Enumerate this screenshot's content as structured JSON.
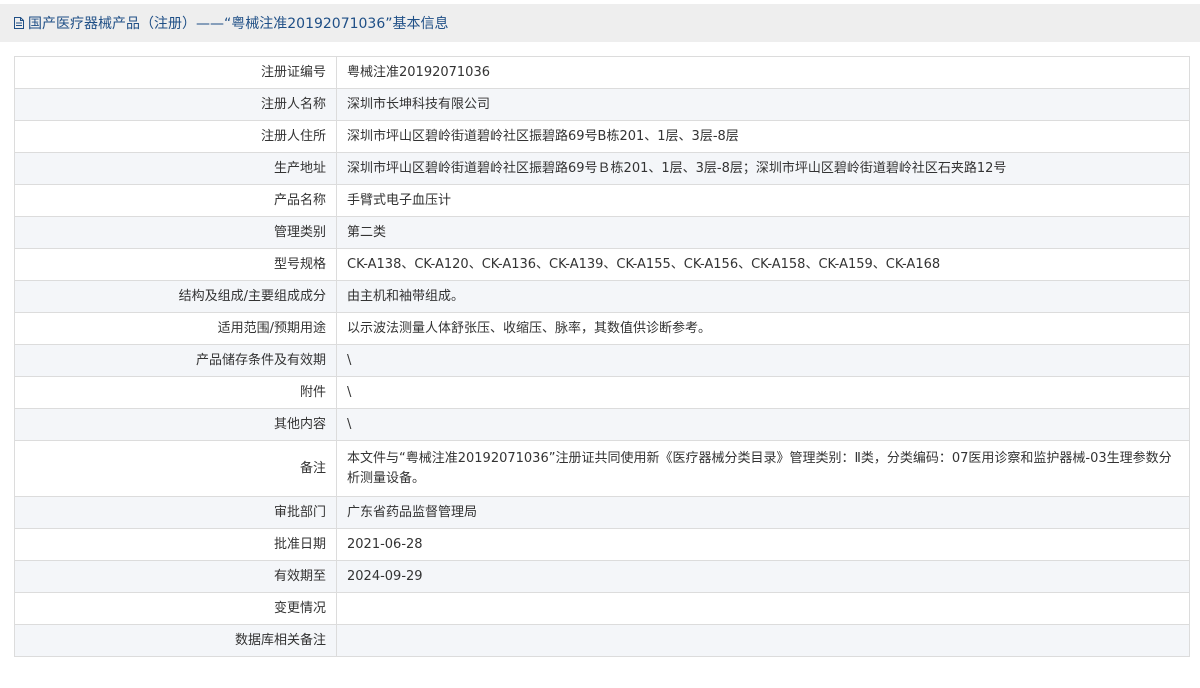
{
  "header": {
    "title": "国产医疗器械产品（注册）——“粤械注准20192071036”基本信息"
  },
  "rows": [
    {
      "label": "注册证编号",
      "value": "粤械注准20192071036"
    },
    {
      "label": "注册人名称",
      "value": "深圳市长坤科技有限公司"
    },
    {
      "label": "注册人住所",
      "value": "深圳市坪山区碧岭街道碧岭社区振碧路69号B栋201、1层、3层-8层"
    },
    {
      "label": "生产地址",
      "value": "深圳市坪山区碧岭街道碧岭社区振碧路69号Ｂ栋201、1层、3层-8层；深圳市坪山区碧岭街道碧岭社区石夹路12号"
    },
    {
      "label": "产品名称",
      "value": "手臂式电子血压计"
    },
    {
      "label": "管理类别",
      "value": "第二类"
    },
    {
      "label": "型号规格",
      "value": "CK-A138、CK-A120、CK-A136、CK-A139、CK-A155、CK-A156、CK-A158、CK-A159、CK-A168"
    },
    {
      "label": "结构及组成/主要组成成分",
      "value": "由主机和袖带组成。"
    },
    {
      "label": "适用范围/预期用途",
      "value": "以示波法测量人体舒张压、收缩压、脉率，其数值供诊断参考。"
    },
    {
      "label": "产品储存条件及有效期",
      "value": "\\"
    },
    {
      "label": "附件",
      "value": "\\"
    },
    {
      "label": "其他内容",
      "value": "\\"
    },
    {
      "label": "备注",
      "value": "本文件与“粤械注准20192071036”注册证共同使用新《医疗器械分类目录》管理类别：Ⅱ类，分类编码：07医用诊察和监护器械-03生理参数分析测量设备。"
    },
    {
      "label": "审批部门",
      "value": "广东省药品监督管理局"
    },
    {
      "label": "批准日期",
      "value": "2021-06-28"
    },
    {
      "label": "有效期至",
      "value": "2024-09-29"
    },
    {
      "label": "变更情况",
      "value": ""
    },
    {
      "label": "数据库相关备注",
      "value": ""
    }
  ]
}
